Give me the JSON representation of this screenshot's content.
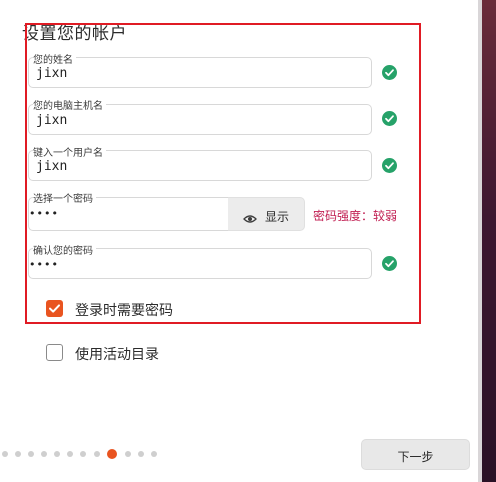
{
  "page": {
    "title": "设置您的帐户"
  },
  "form": {
    "name": {
      "label": "您的姓名",
      "value": "jixn"
    },
    "computer_name": {
      "label": "您的电脑主机名",
      "value": "jixn"
    },
    "username": {
      "label": "键入一个用户名",
      "value": "jixn"
    },
    "password": {
      "label": "选择一个密码",
      "value": "••••",
      "show_label": "显示",
      "strength": "密码强度：较弱"
    },
    "confirm_password": {
      "label": "确认您的密码",
      "value": "••••"
    }
  },
  "options": {
    "require_password": {
      "label": "登录时需要密码",
      "checked": true
    },
    "active_directory": {
      "label": "使用活动目录",
      "checked": false
    }
  },
  "progress": {
    "total_steps": 12,
    "current_step": 9
  },
  "navigation": {
    "next_label": "下一步"
  },
  "colors": {
    "accent": "#e95420",
    "success": "#26a269",
    "warning_text": "#c01c50",
    "highlight_border": "#e01b24"
  },
  "icons": {
    "valid": "check-circle-icon",
    "reveal": "eye-icon"
  }
}
